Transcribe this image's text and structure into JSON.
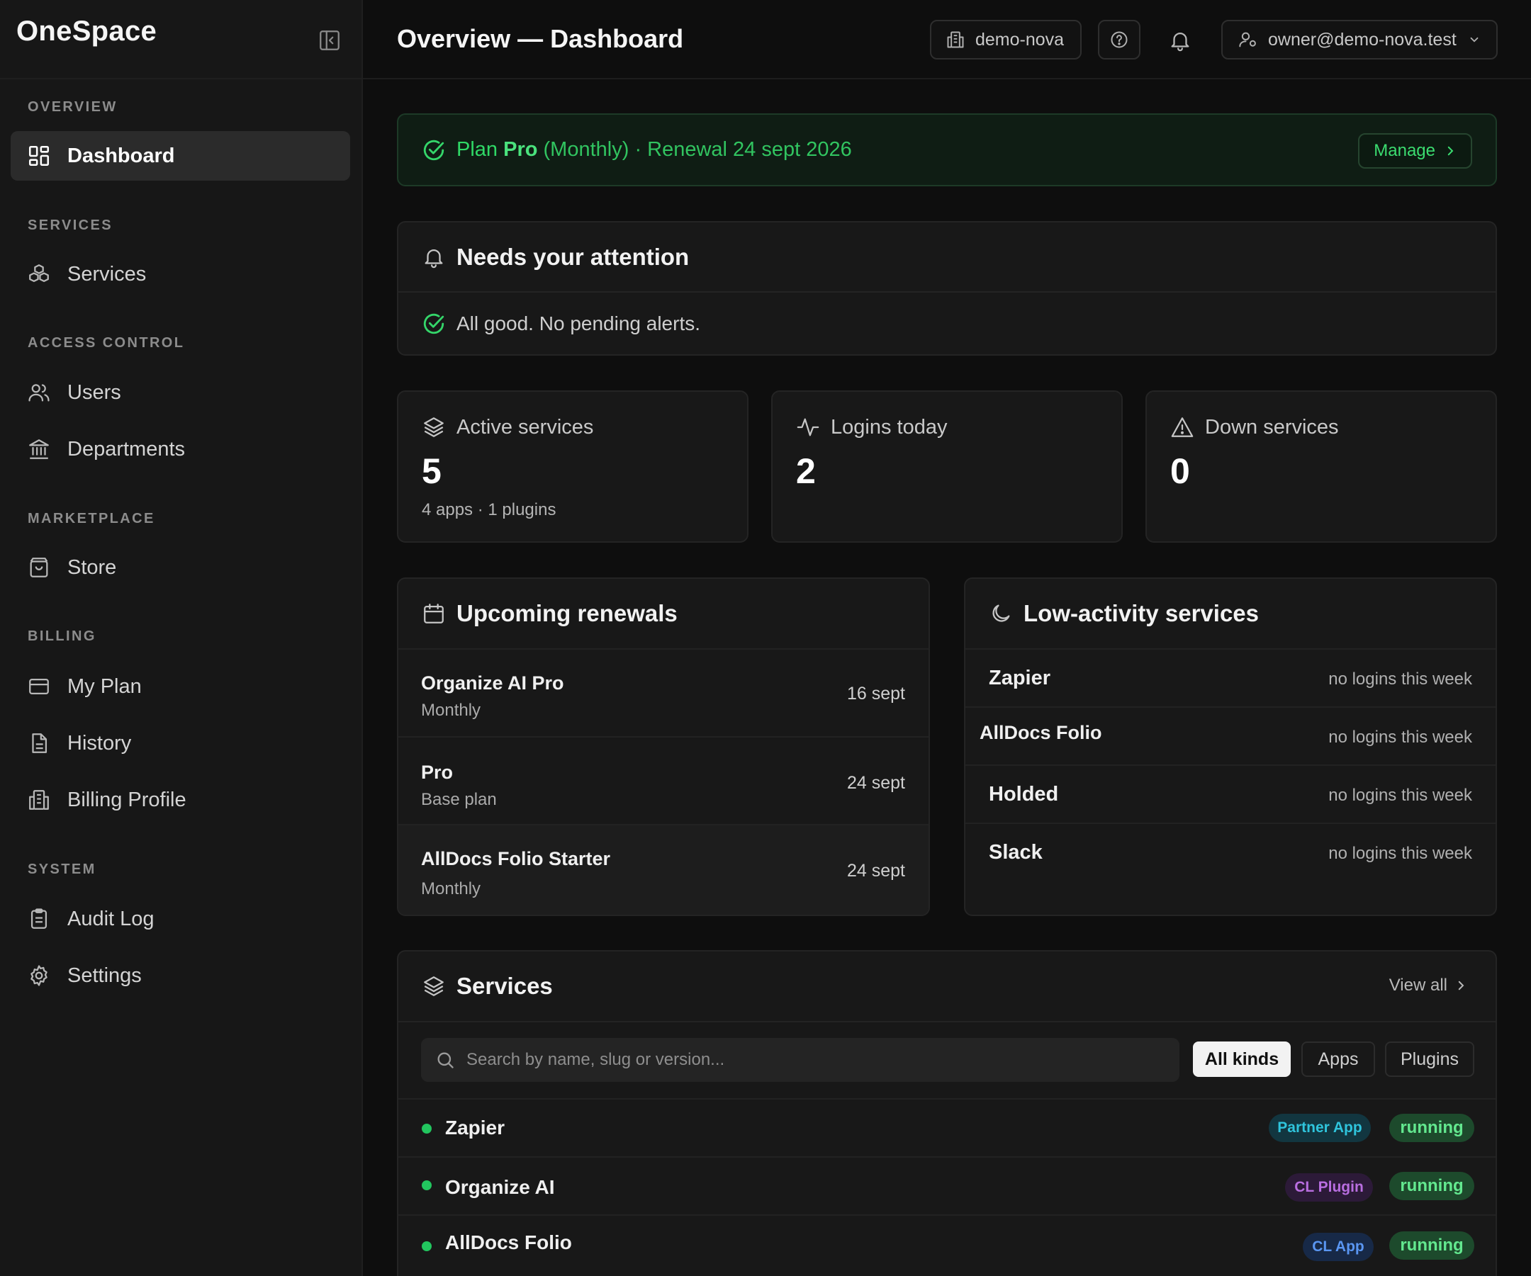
{
  "app": {
    "brand": "OneSpace"
  },
  "sidebar": {
    "sections": [
      {
        "label": "OVERVIEW",
        "items": [
          {
            "label": "Dashboard",
            "icon": "grid-icon",
            "active": true
          }
        ]
      },
      {
        "label": "SERVICES",
        "items": [
          {
            "label": "Services",
            "icon": "boxes-icon"
          }
        ]
      },
      {
        "label": "ACCESS CONTROL",
        "items": [
          {
            "label": "Users",
            "icon": "users-icon"
          },
          {
            "label": "Departments",
            "icon": "building-columns-icon"
          }
        ]
      },
      {
        "label": "MARKETPLACE",
        "items": [
          {
            "label": "Store",
            "icon": "shopping-bag-icon"
          }
        ]
      },
      {
        "label": "BILLING",
        "items": [
          {
            "label": "My Plan",
            "icon": "credit-card-icon"
          },
          {
            "label": "History",
            "icon": "document-icon"
          },
          {
            "label": "Billing Profile",
            "icon": "building-icon"
          }
        ]
      },
      {
        "label": "SYSTEM",
        "items": [
          {
            "label": "Audit Log",
            "icon": "clipboard-icon"
          },
          {
            "label": "Settings",
            "icon": "gear-icon"
          }
        ]
      }
    ]
  },
  "header": {
    "title": "Overview — Dashboard",
    "org": "demo-nova",
    "user_email": "owner@demo-nova.test"
  },
  "plan_banner": {
    "prefix": "Plan",
    "plan_name": "Pro",
    "cycle": "(Monthly)",
    "renewal": "· Renewal 24 sept 2026",
    "manage_label": "Manage",
    "accent_color": "#2fd866"
  },
  "attention": {
    "title": "Needs your attention",
    "message": "All good. No pending alerts."
  },
  "stats": {
    "active_services": {
      "label": "Active services",
      "value": "5",
      "sub": "4 apps · 1 plugins"
    },
    "logins_today": {
      "label": "Logins today",
      "value": "2"
    },
    "down_services": {
      "label": "Down services",
      "value": "0"
    }
  },
  "renewals": {
    "title": "Upcoming renewals",
    "rows": [
      {
        "name": "Organize AI Pro",
        "sub": "Monthly",
        "date": "16 sept"
      },
      {
        "name": "Pro",
        "sub": "Base plan",
        "date": "24 sept"
      },
      {
        "name": "AllDocs Folio Starter",
        "sub": "Monthly",
        "date": "24 sept"
      }
    ]
  },
  "low_activity": {
    "title": "Low-activity services",
    "rows": [
      {
        "name": "Zapier",
        "note": "no logins this week"
      },
      {
        "name": "AllDocs Folio",
        "note": "no logins this week"
      },
      {
        "name": "Holded",
        "note": "no logins this week"
      },
      {
        "name": "Slack",
        "note": "no logins this week"
      }
    ]
  },
  "services": {
    "title": "Services",
    "view_all": "View all",
    "search_placeholder": "Search by name, slug or version...",
    "filters": [
      "All kinds",
      "Apps",
      "Plugins"
    ],
    "active_filter": "All kinds",
    "rows": [
      {
        "name": "Zapier",
        "kind": "Partner App",
        "kind_color": "#22b8cf",
        "status": "running"
      },
      {
        "name": "Organize AI",
        "kind": "CL Plugin",
        "kind_color": "#b26ad9",
        "status": "running"
      },
      {
        "name": "AllDocs Folio",
        "kind": "CL App",
        "kind_color": "#4f8ef0",
        "status": "running"
      }
    ]
  }
}
